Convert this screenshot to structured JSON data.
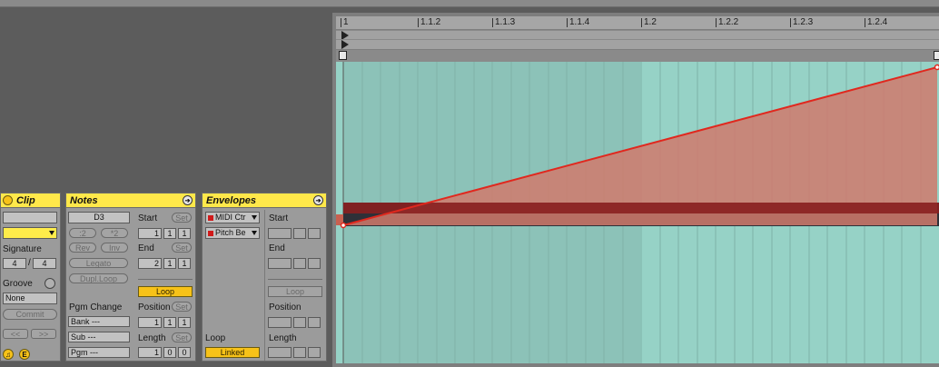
{
  "clip": {
    "title": "Clip",
    "signature_label": "Signature",
    "sig_num": "4",
    "sig_sep": "/",
    "sig_den": "4",
    "groove_label": "Groove",
    "groove_value": "None",
    "commit": "Commit",
    "prev": "<<",
    "next": ">>"
  },
  "notes": {
    "title": "Notes",
    "pitch": "D3",
    "half": ":2",
    "double": "*2",
    "rev": "Rev",
    "inv": "Inv",
    "legato": "Legato",
    "dupl_loop": "Dupl.Loop",
    "pgm_change": "Pgm Change",
    "bank": "Bank ---",
    "sub": "Sub ---",
    "pgm": "Pgm ---",
    "start_label": "Start",
    "end_label": "End",
    "position_label": "Position",
    "length_label": "Length",
    "set": "Set",
    "loop": "Loop",
    "start_vals": [
      "1",
      "1",
      "1"
    ],
    "end_vals": [
      "2",
      "1",
      "1"
    ],
    "position_vals": [
      "1",
      "1",
      "1"
    ],
    "length_vals": [
      "1",
      "0",
      "0"
    ]
  },
  "envelopes": {
    "title": "Envelopes",
    "device": "MIDI Ctr",
    "control": "Pitch Be",
    "loop_label": "Loop",
    "linked": "Linked",
    "start_label": "Start",
    "end_label": "End",
    "loop": "Loop",
    "position_label": "Position",
    "length_label": "Length"
  },
  "ruler": {
    "ticks": [
      "1",
      "1.1.2",
      "1.1.3",
      "1.1.4",
      "1.2",
      "1.2.2",
      "1.2.3",
      "1.2.4"
    ]
  },
  "colors": {
    "panel_header": "#ffe84a",
    "loop_button": "#f7c218",
    "grid_bg": "#96d2c6",
    "grid_bg_dark": "#8cc2b8",
    "envelope_line": "#e0281e",
    "envelope_fill": "#d07a6c"
  }
}
